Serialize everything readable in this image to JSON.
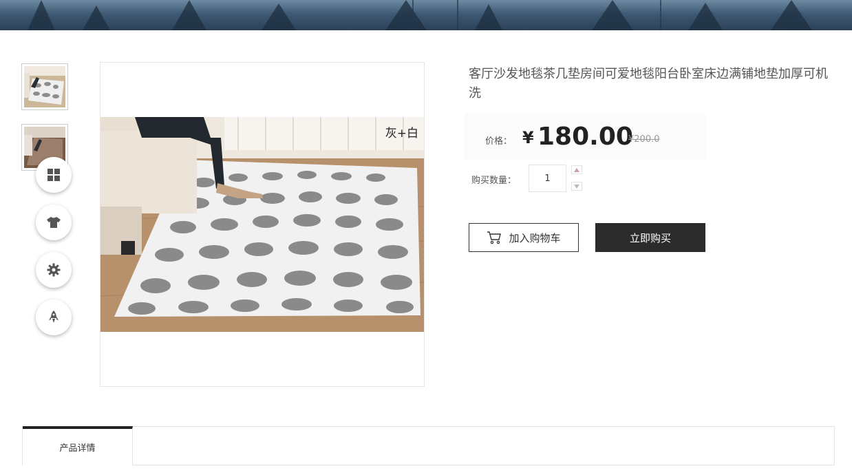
{
  "product": {
    "title": "客厅沙发地毯茶几垫房间可爱地毯阳台卧室床边满铺地垫加厚可机洗",
    "color_tag": "灰+白",
    "price_label": "价格：",
    "price_symbol": "¥",
    "price": "180.00",
    "original_price": "¥200.0",
    "qty_label": "购买数量：",
    "quantity": "1"
  },
  "actions": {
    "add_to_cart": "加入购物车",
    "buy_now": "立即购买"
  },
  "tabs": [
    {
      "label": "产品详情",
      "active": true
    }
  ],
  "floating_toolbar": [
    "grid-icon",
    "tshirt-icon",
    "gear-icon",
    "rocket-icon"
  ],
  "colors": {
    "accent": "#2b2b2b",
    "rug_gray": "#8a8a8a",
    "rug_white": "#f2f2f2"
  }
}
